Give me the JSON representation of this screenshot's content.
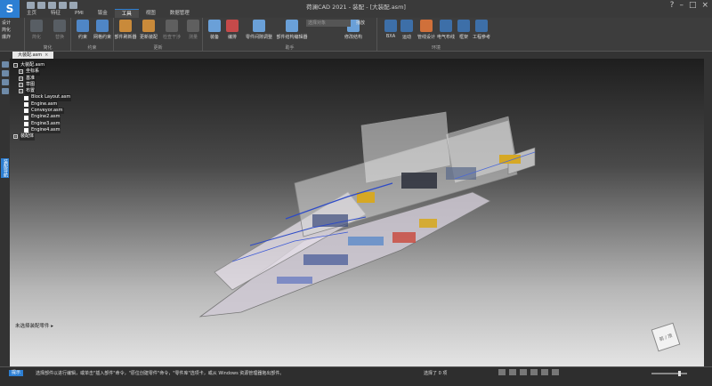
{
  "window": {
    "title": "荷澜CAD 2021 - 装配 - [大装配.asm]"
  },
  "menu_tabs": [
    "主页",
    "特征",
    "PMI",
    "钣金",
    "工具",
    "视图",
    "数据管理"
  ],
  "active_tab": "工具",
  "ribbon": {
    "small_rows": [
      "设计",
      "简化",
      "爆炸"
    ],
    "groups": [
      {
        "label": "爆炸",
        "buttons": [
          {
            "label": "爆炸"
          },
          {
            "label": "自动爆炸"
          }
        ]
      },
      {
        "label": "简化",
        "buttons": [
          {
            "label": "简化"
          },
          {
            "label": "替换"
          },
          {
            "label": "移除"
          }
        ]
      },
      {
        "label": "约束",
        "buttons": [
          {
            "label": "约束"
          },
          {
            "label": "网格约束"
          }
        ]
      },
      {
        "label": "零件",
        "buttons": [
          {
            "label": "插入零件"
          },
          {
            "label": "新建零件"
          }
        ]
      },
      {
        "label": "更新",
        "buttons": [
          {
            "label": "部件刷新器"
          },
          {
            "label": "更新装配"
          },
          {
            "label": "检查干涉"
          },
          {
            "label": "测量"
          }
        ]
      },
      {
        "label": "助手",
        "buttons": [
          {
            "label": "装备"
          },
          {
            "label": "编排"
          },
          {
            "label": "零件间隙调整"
          },
          {
            "label": "部件结构编辑器"
          },
          {
            "label": "修改结构"
          }
        ]
      },
      {
        "label": "环境",
        "buttons": [
          {
            "label": "BXA"
          },
          {
            "label": "运动"
          },
          {
            "label": "管线设计"
          },
          {
            "label": "电气布线"
          },
          {
            "label": "框架"
          },
          {
            "label": "工程参考"
          }
        ]
      }
    ],
    "dropdown_placeholder": "选择对象",
    "note_tag": "播放"
  },
  "document_tab": {
    "label": "大装配.asm"
  },
  "side_tab": "装配导航",
  "tree": [
    {
      "label": "大装配.asm",
      "level": 0,
      "type": "expander"
    },
    {
      "label": "坐标系",
      "level": 1,
      "type": "expander"
    },
    {
      "label": "基准",
      "level": 1,
      "type": "expander"
    },
    {
      "label": "草图",
      "level": 1,
      "type": "expander"
    },
    {
      "label": "布置",
      "level": 1,
      "type": "expander"
    },
    {
      "label": "Block Layout.asm",
      "level": 1,
      "type": "check"
    },
    {
      "label": "Engine.asm",
      "level": 1,
      "type": "check"
    },
    {
      "label": "Conveyor.asm",
      "level": 1,
      "type": "check"
    },
    {
      "label": "Engine2.asm",
      "level": 1,
      "type": "check"
    },
    {
      "label": "Engine3.asm",
      "level": 1,
      "type": "check"
    },
    {
      "label": "Engine4.asm",
      "level": 1,
      "type": "check"
    },
    {
      "label": "装配体",
      "level": 0,
      "type": "expander"
    }
  ],
  "viewport": {
    "hint": "未选择装配零件 ▸",
    "view_cube": "前 / 顶"
  },
  "status": {
    "tag": "提示",
    "message": "选择部件以进行编辑，或单击\"插入部件\"命令，\"原位创建零件\"命令，\"零件库\"选项卡，或从 Windows 资源管理器拖出部件。",
    "selected": "选择了 0 项"
  },
  "colors": {
    "accent": "#2d7fd3"
  }
}
